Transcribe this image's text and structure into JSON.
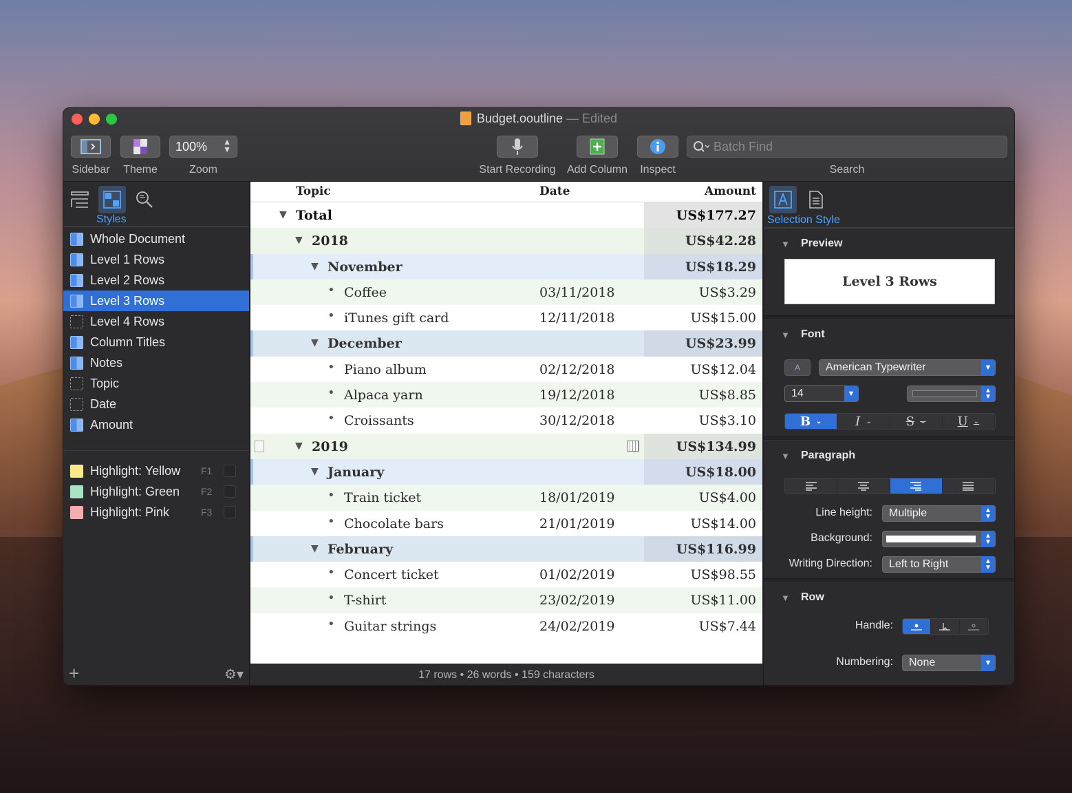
{
  "window": {
    "title": "Budget.ooutline",
    "title_suffix": "— Edited"
  },
  "toolbar": {
    "sidebar_label": "Sidebar",
    "theme_label": "Theme",
    "zoom_value": "100%",
    "zoom_label": "Zoom",
    "record_label": "Start Recording",
    "add_column_label": "Add Column",
    "inspect_label": "Inspect",
    "search_placeholder": "Batch Find",
    "search_label": "Search"
  },
  "sidebar": {
    "active_tab_label": "Styles",
    "styles": [
      {
        "label": "Whole Document",
        "dashed": false,
        "selected": false
      },
      {
        "label": "Level 1 Rows",
        "dashed": false,
        "selected": false
      },
      {
        "label": "Level 2 Rows",
        "dashed": false,
        "selected": false
      },
      {
        "label": "Level 3 Rows",
        "dashed": false,
        "selected": true
      },
      {
        "label": "Level 4 Rows",
        "dashed": true,
        "selected": false
      },
      {
        "label": "Column Titles",
        "dashed": false,
        "selected": false
      },
      {
        "label": "Notes",
        "dashed": false,
        "selected": false
      },
      {
        "label": "Topic",
        "dashed": true,
        "selected": false
      },
      {
        "label": "Date",
        "dashed": true,
        "selected": false
      },
      {
        "label": "Amount",
        "dashed": false,
        "selected": false
      }
    ],
    "highlights": [
      {
        "label": "Highlight: Yellow",
        "key": "F1",
        "color": "#fbe98a"
      },
      {
        "label": "Highlight: Green",
        "key": "F2",
        "color": "#a8e3c4"
      },
      {
        "label": "Highlight: Pink",
        "key": "F3",
        "color": "#f5aeb0"
      }
    ]
  },
  "outline": {
    "columns": {
      "topic": "Topic",
      "date": "Date",
      "amount": "Amount"
    },
    "rows": [
      {
        "level": 1,
        "topic": "Total",
        "date": "",
        "amount": "US$177.27",
        "bg": "#ffffff",
        "amt_bg": "#e3e3e3",
        "expandable": true
      },
      {
        "level": 2,
        "topic": "2018",
        "date": "",
        "amount": "US$42.28",
        "bg": "#eef6ec",
        "amt_bg": "#dfe3de",
        "expandable": true
      },
      {
        "level": 3,
        "topic": "November",
        "date": "",
        "amount": "US$18.29",
        "bg": "#e2edf9",
        "amt_bg": "#d3dcea",
        "expandable": true
      },
      {
        "level": 4,
        "topic": "Coffee",
        "date": "03/11/2018",
        "amount": "US$3.29",
        "bg": "#f0f7ee",
        "amt_bg": "#f0f7ee",
        "expandable": false
      },
      {
        "level": 4,
        "topic": "iTunes gift card",
        "date": "12/11/2018",
        "amount": "US$15.00",
        "bg": "#ffffff",
        "amt_bg": "#ffffff",
        "expandable": false
      },
      {
        "level": 3,
        "topic": "December",
        "date": "",
        "amount": "US$23.99",
        "bg": "#dbe8f2",
        "amt_bg": "#cfdae6",
        "expandable": true
      },
      {
        "level": 4,
        "topic": "Piano album",
        "date": "02/12/2018",
        "amount": "US$12.04",
        "bg": "#ffffff",
        "amt_bg": "#ffffff",
        "expandable": false
      },
      {
        "level": 4,
        "topic": "Alpaca yarn",
        "date": "19/12/2018",
        "amount": "US$8.85",
        "bg": "#f0f7ee",
        "amt_bg": "#f0f7ee",
        "expandable": false
      },
      {
        "level": 4,
        "topic": "Croissants",
        "date": "30/12/2018",
        "amount": "US$3.10",
        "bg": "#ffffff",
        "amt_bg": "#ffffff",
        "expandable": false
      },
      {
        "level": 2,
        "topic": "2019",
        "date": "",
        "amount": "US$134.99",
        "bg": "#eef6ec",
        "amt_bg": "#dfe3de",
        "expandable": true,
        "has_note": true
      },
      {
        "level": 3,
        "topic": "January",
        "date": "",
        "amount": "US$18.00",
        "bg": "#e2edf9",
        "amt_bg": "#d3dcea",
        "expandable": true
      },
      {
        "level": 4,
        "topic": "Train ticket",
        "date": "18/01/2019",
        "amount": "US$4.00",
        "bg": "#f0f7ee",
        "amt_bg": "#f0f7ee",
        "expandable": false
      },
      {
        "level": 4,
        "topic": "Chocolate bars",
        "date": "21/01/2019",
        "amount": "US$14.00",
        "bg": "#ffffff",
        "amt_bg": "#ffffff",
        "expandable": false
      },
      {
        "level": 3,
        "topic": "February",
        "date": "",
        "amount": "US$116.99",
        "bg": "#dbe8f2",
        "amt_bg": "#cfdae6",
        "expandable": true
      },
      {
        "level": 4,
        "topic": "Concert ticket",
        "date": "01/02/2019",
        "amount": "US$98.55",
        "bg": "#ffffff",
        "amt_bg": "#ffffff",
        "expandable": false
      },
      {
        "level": 4,
        "topic": "T-shirt",
        "date": "23/02/2019",
        "amount": "US$11.00",
        "bg": "#f0f7ee",
        "amt_bg": "#f0f7ee",
        "expandable": false
      },
      {
        "level": 4,
        "topic": "Guitar strings",
        "date": "24/02/2019",
        "amount": "US$7.44",
        "bg": "#ffffff",
        "amt_bg": "#ffffff",
        "expandable": false
      }
    ]
  },
  "status": {
    "text": "17 rows • 26 words • 159 characters"
  },
  "inspector": {
    "active_tab_label": "Selection Style",
    "preview": {
      "heading": "Preview",
      "sample": "Level 3 Rows"
    },
    "font": {
      "heading": "Font",
      "family": "American Typewriter",
      "size": "14"
    },
    "paragraph": {
      "heading": "Paragraph",
      "line_height_label": "Line height:",
      "line_height_value": "Multiple",
      "background_label": "Background:",
      "writing_direction_label": "Writing Direction:",
      "writing_direction_value": "Left to Right"
    },
    "row": {
      "heading": "Row",
      "handle_label": "Handle:",
      "numbering_label": "Numbering:",
      "numbering_value": "None"
    }
  },
  "colors": {
    "accent": "#2f6fd6",
    "link_blue": "#4da3ff"
  }
}
